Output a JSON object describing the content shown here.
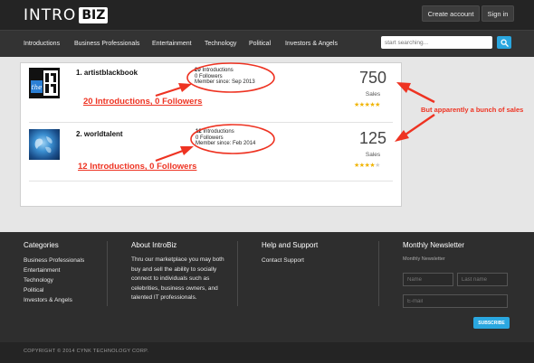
{
  "header": {
    "logo_text": "INTRO",
    "logo_badge": "BIZ",
    "create_account": "Create account",
    "sign_in": "Sign in"
  },
  "nav": {
    "items": [
      "Introductions",
      "Business Professionals",
      "Entertainment",
      "Technology",
      "Political",
      "Investors & Angels"
    ],
    "search_placeholder": "start searching..."
  },
  "listings": [
    {
      "title": "1. artistblackbook",
      "introductions_count": "20",
      "introductions_label": "Introductions",
      "followers": "0 Followers",
      "member_since": "Member since: Sep 2013",
      "sales": "750",
      "sales_label": "Sales",
      "rating": 5,
      "thumb_text": "the"
    },
    {
      "title": "2. worldtalent",
      "introductions_count": "12",
      "introductions_label": "Introductions",
      "followers": "0 Followers",
      "member_since": "Member since: Feb 2014",
      "sales": "125",
      "sales_label": "Sales",
      "rating": 4
    }
  ],
  "annotations": {
    "row1": "20 Introductions, 0 Followers",
    "row2": "12 Introductions, 0 Followers",
    "right": "But apparently a bunch of sales",
    "color": "#ee3322"
  },
  "footer": {
    "categories_title": "Categories",
    "categories": [
      "Business Professionals",
      "Entertainment",
      "Technology",
      "Political",
      "Investors & Angels"
    ],
    "about_title": "About IntroBiz",
    "about_text": "Thru our marketplace you may both buy and sell the ability to socially connect to individuals such as celebrities, business owners, and talented IT professionals.",
    "support_title": "Help and Support",
    "support_link": "Contact Support",
    "newsletter_title": "Monthly Newsletter",
    "newsletter_sub": "Monthly Newsletter",
    "name_placeholder": "Name",
    "lastname_placeholder": "Last name",
    "email_placeholder": "E-mail",
    "subscribe": "SUBSCRIBE",
    "copyright": "COPYRIGHT © 2014 CYNK TECHNOLOGY CORP."
  },
  "colors": {
    "accent": "#2aa7e0",
    "star": "#f0b400"
  }
}
